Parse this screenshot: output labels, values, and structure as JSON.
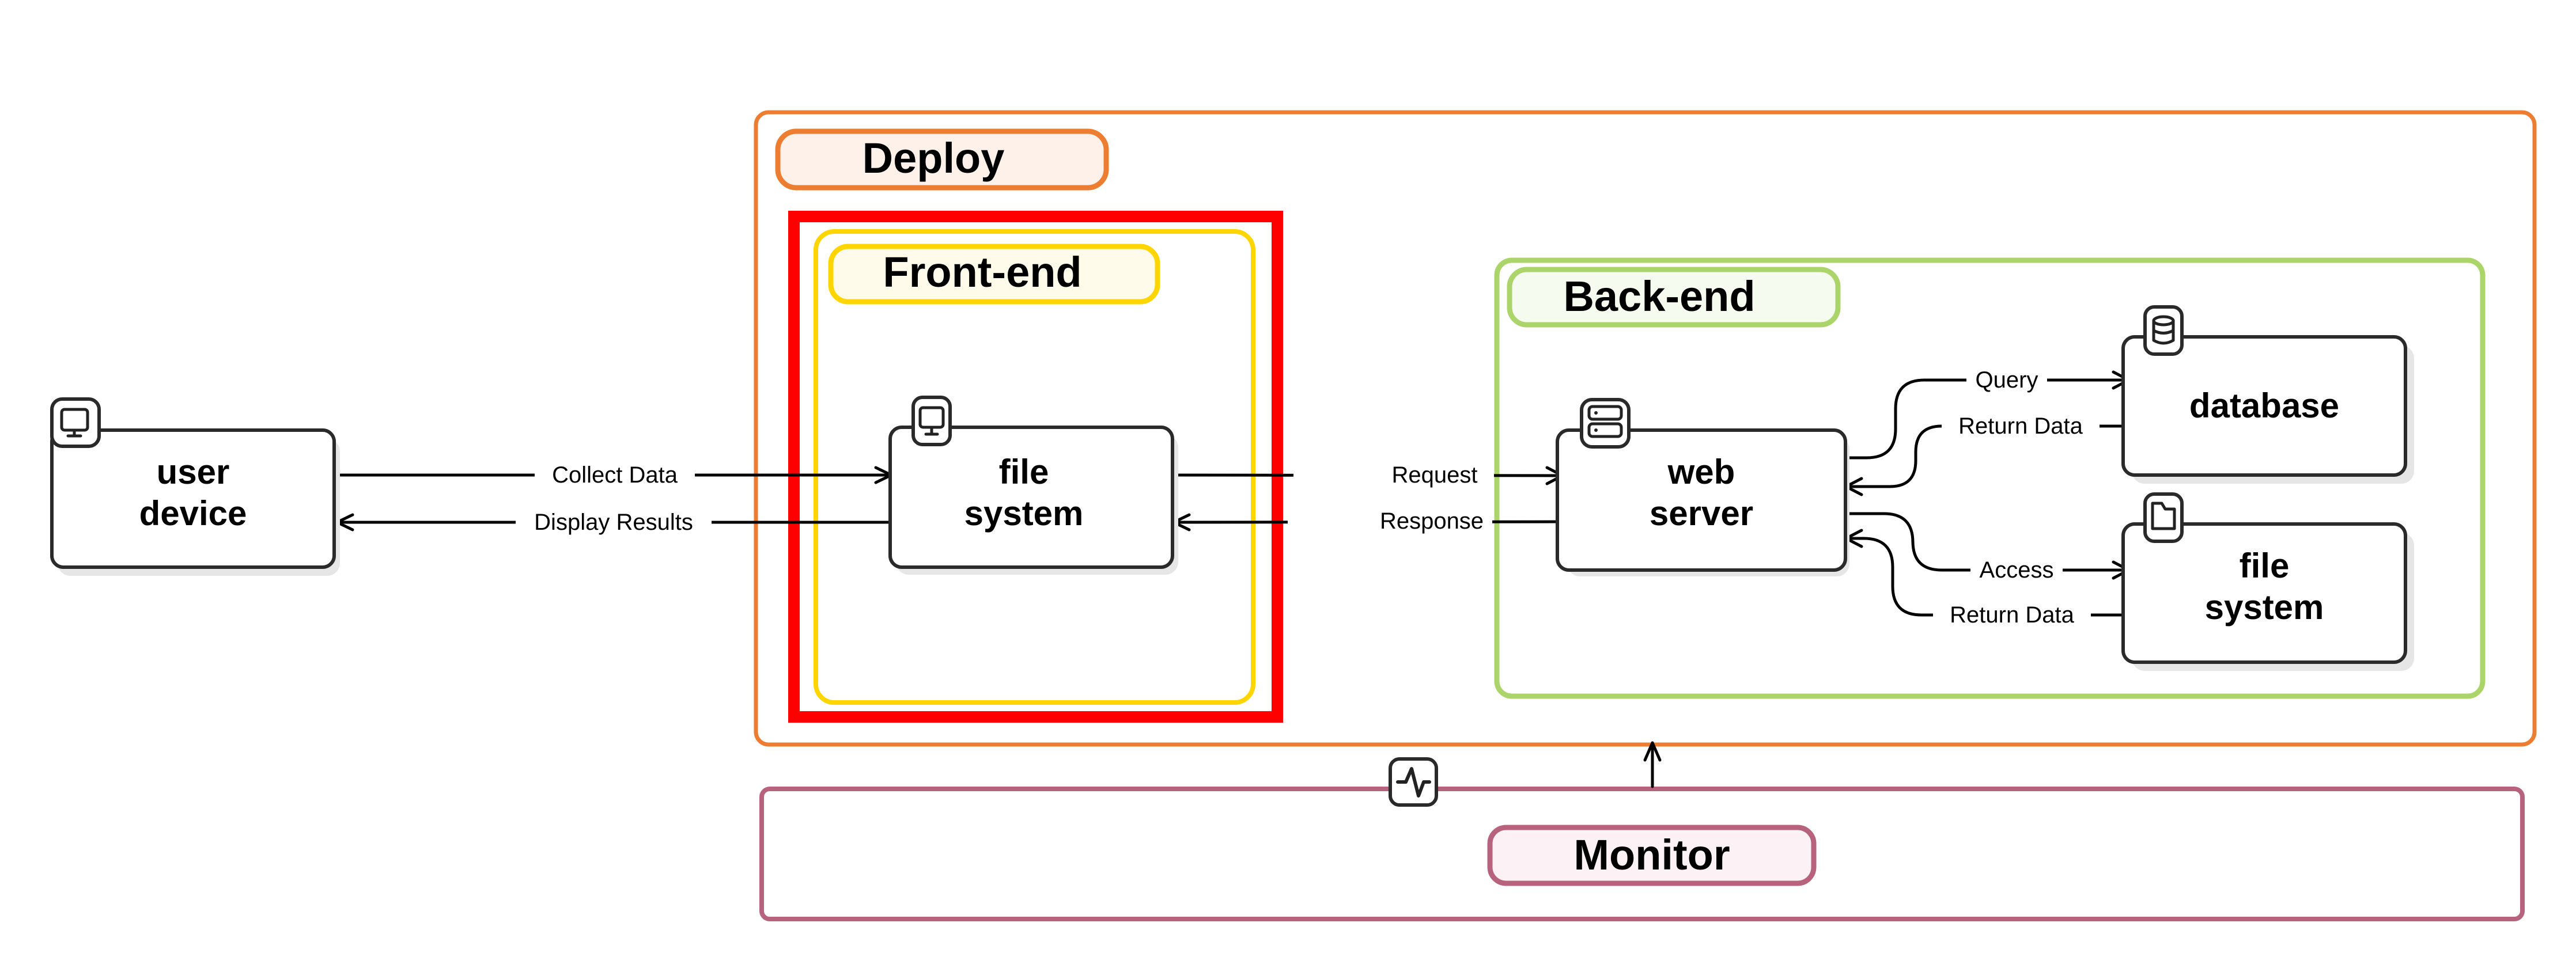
{
  "diagram": {
    "colors": {
      "deploy": "#ED7D31",
      "deploy_fill": "#FDF1EA",
      "frontend": "#FFD500",
      "frontend_fill": "#FFFBEA",
      "backend": "#ABD46A",
      "backend_fill": "#F6FBEF",
      "monitor": "#B8637D",
      "monitor_fill": "#FCF2F5",
      "highlight": "#FF0000",
      "edge": "#000000"
    },
    "groups": {
      "deploy": {
        "label": "Deploy"
      },
      "frontend": {
        "label": "Front-end"
      },
      "backend": {
        "label": "Back-end"
      },
      "monitor": {
        "label": "Monitor",
        "icon": "activity-icon"
      }
    },
    "nodes": {
      "user_device": {
        "line1": "user",
        "line2": "device",
        "icon": "monitor-icon"
      },
      "frontend_fs": {
        "line1": "file",
        "line2": "system",
        "icon": "monitor-icon"
      },
      "web_server": {
        "line1": "web",
        "line2": "server",
        "icon": "server-icon"
      },
      "database": {
        "line1": "database",
        "icon": "database-icon"
      },
      "backend_fs": {
        "line1": "file",
        "line2": "system",
        "icon": "folder-icon"
      }
    },
    "edges": {
      "collect": "Collect Data",
      "display": "Display Results",
      "request": "Request",
      "response": "Response",
      "query": "Query",
      "db_return": "Return Data",
      "access": "Access",
      "fs_return": "Return Data"
    }
  }
}
